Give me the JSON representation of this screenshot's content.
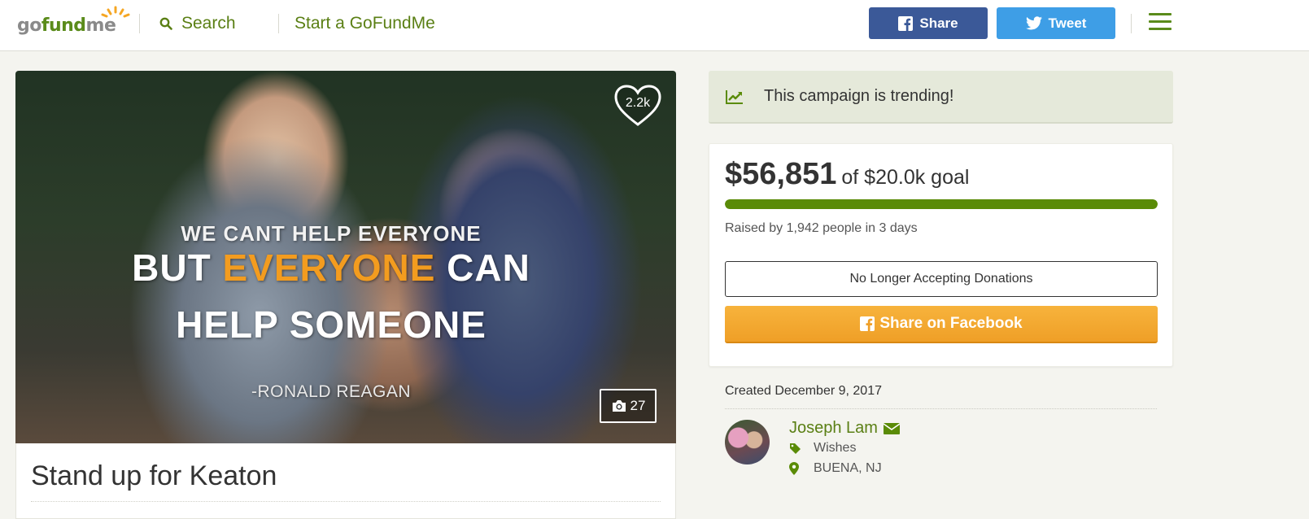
{
  "header": {
    "logo": {
      "go": "go",
      "fund": "fund",
      "me": "me"
    },
    "search_label": "Search",
    "start_label": "Start a GoFundMe",
    "share_label": "Share",
    "tweet_label": "Tweet"
  },
  "hero": {
    "quote_line1": "WE CANT HELP EVERYONE",
    "quote_line2_pre": "BUT ",
    "quote_line2_hl": "EVERYONE",
    "quote_line2_post": " CAN",
    "quote_line3": "HELP SOMEONE",
    "quote_attrib": "-RONALD REAGAN",
    "hearts": "2.2k",
    "photo_count": "27"
  },
  "campaign": {
    "title": "Stand up for Keaton"
  },
  "trending": {
    "text": "This campaign is trending!"
  },
  "donation": {
    "raised": "$56,851",
    "goal": "of $20.0k goal",
    "progress_fraction": 1.0,
    "stats": "Raised by 1,942 people in 3 days",
    "status_button": "No Longer Accepting Donations",
    "fb_share_label": "Share on Facebook"
  },
  "details": {
    "created": "Created December 9, 2017",
    "organizer_name": "Joseph Lam",
    "category": "Wishes",
    "location": "BUENA, NJ"
  },
  "colors": {
    "brand_green": "#5a8b07",
    "facebook_blue": "#3b5998",
    "twitter_blue": "#3e9ee6",
    "cta_orange": "#f39c1f"
  }
}
